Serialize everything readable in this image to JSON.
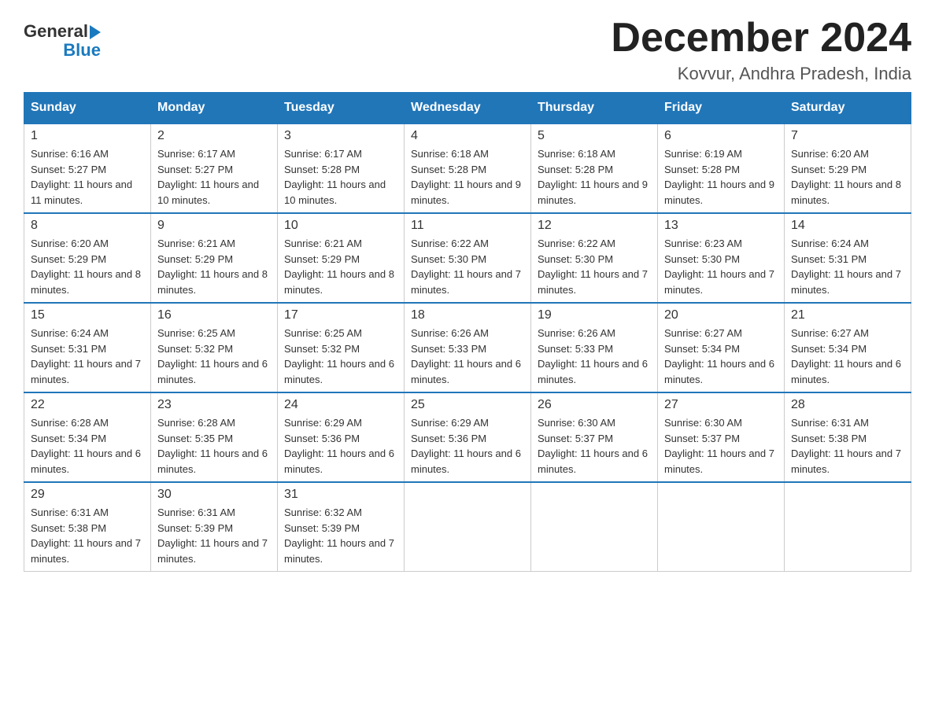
{
  "logo": {
    "text_general": "General",
    "text_blue": "Blue"
  },
  "title": "December 2024",
  "location": "Kovvur, Andhra Pradesh, India",
  "days_of_week": [
    "Sunday",
    "Monday",
    "Tuesday",
    "Wednesday",
    "Thursday",
    "Friday",
    "Saturday"
  ],
  "weeks": [
    [
      {
        "day": "1",
        "sunrise": "6:16 AM",
        "sunset": "5:27 PM",
        "daylight": "11 hours and 11 minutes."
      },
      {
        "day": "2",
        "sunrise": "6:17 AM",
        "sunset": "5:27 PM",
        "daylight": "11 hours and 10 minutes."
      },
      {
        "day": "3",
        "sunrise": "6:17 AM",
        "sunset": "5:28 PM",
        "daylight": "11 hours and 10 minutes."
      },
      {
        "day": "4",
        "sunrise": "6:18 AM",
        "sunset": "5:28 PM",
        "daylight": "11 hours and 9 minutes."
      },
      {
        "day": "5",
        "sunrise": "6:18 AM",
        "sunset": "5:28 PM",
        "daylight": "11 hours and 9 minutes."
      },
      {
        "day": "6",
        "sunrise": "6:19 AM",
        "sunset": "5:28 PM",
        "daylight": "11 hours and 9 minutes."
      },
      {
        "day": "7",
        "sunrise": "6:20 AM",
        "sunset": "5:29 PM",
        "daylight": "11 hours and 8 minutes."
      }
    ],
    [
      {
        "day": "8",
        "sunrise": "6:20 AM",
        "sunset": "5:29 PM",
        "daylight": "11 hours and 8 minutes."
      },
      {
        "day": "9",
        "sunrise": "6:21 AM",
        "sunset": "5:29 PM",
        "daylight": "11 hours and 8 minutes."
      },
      {
        "day": "10",
        "sunrise": "6:21 AM",
        "sunset": "5:29 PM",
        "daylight": "11 hours and 8 minutes."
      },
      {
        "day": "11",
        "sunrise": "6:22 AM",
        "sunset": "5:30 PM",
        "daylight": "11 hours and 7 minutes."
      },
      {
        "day": "12",
        "sunrise": "6:22 AM",
        "sunset": "5:30 PM",
        "daylight": "11 hours and 7 minutes."
      },
      {
        "day": "13",
        "sunrise": "6:23 AM",
        "sunset": "5:30 PM",
        "daylight": "11 hours and 7 minutes."
      },
      {
        "day": "14",
        "sunrise": "6:24 AM",
        "sunset": "5:31 PM",
        "daylight": "11 hours and 7 minutes."
      }
    ],
    [
      {
        "day": "15",
        "sunrise": "6:24 AM",
        "sunset": "5:31 PM",
        "daylight": "11 hours and 7 minutes."
      },
      {
        "day": "16",
        "sunrise": "6:25 AM",
        "sunset": "5:32 PM",
        "daylight": "11 hours and 6 minutes."
      },
      {
        "day": "17",
        "sunrise": "6:25 AM",
        "sunset": "5:32 PM",
        "daylight": "11 hours and 6 minutes."
      },
      {
        "day": "18",
        "sunrise": "6:26 AM",
        "sunset": "5:33 PM",
        "daylight": "11 hours and 6 minutes."
      },
      {
        "day": "19",
        "sunrise": "6:26 AM",
        "sunset": "5:33 PM",
        "daylight": "11 hours and 6 minutes."
      },
      {
        "day": "20",
        "sunrise": "6:27 AM",
        "sunset": "5:34 PM",
        "daylight": "11 hours and 6 minutes."
      },
      {
        "day": "21",
        "sunrise": "6:27 AM",
        "sunset": "5:34 PM",
        "daylight": "11 hours and 6 minutes."
      }
    ],
    [
      {
        "day": "22",
        "sunrise": "6:28 AM",
        "sunset": "5:34 PM",
        "daylight": "11 hours and 6 minutes."
      },
      {
        "day": "23",
        "sunrise": "6:28 AM",
        "sunset": "5:35 PM",
        "daylight": "11 hours and 6 minutes."
      },
      {
        "day": "24",
        "sunrise": "6:29 AM",
        "sunset": "5:36 PM",
        "daylight": "11 hours and 6 minutes."
      },
      {
        "day": "25",
        "sunrise": "6:29 AM",
        "sunset": "5:36 PM",
        "daylight": "11 hours and 6 minutes."
      },
      {
        "day": "26",
        "sunrise": "6:30 AM",
        "sunset": "5:37 PM",
        "daylight": "11 hours and 6 minutes."
      },
      {
        "day": "27",
        "sunrise": "6:30 AM",
        "sunset": "5:37 PM",
        "daylight": "11 hours and 7 minutes."
      },
      {
        "day": "28",
        "sunrise": "6:31 AM",
        "sunset": "5:38 PM",
        "daylight": "11 hours and 7 minutes."
      }
    ],
    [
      {
        "day": "29",
        "sunrise": "6:31 AM",
        "sunset": "5:38 PM",
        "daylight": "11 hours and 7 minutes."
      },
      {
        "day": "30",
        "sunrise": "6:31 AM",
        "sunset": "5:39 PM",
        "daylight": "11 hours and 7 minutes."
      },
      {
        "day": "31",
        "sunrise": "6:32 AM",
        "sunset": "5:39 PM",
        "daylight": "11 hours and 7 minutes."
      },
      null,
      null,
      null,
      null
    ]
  ]
}
